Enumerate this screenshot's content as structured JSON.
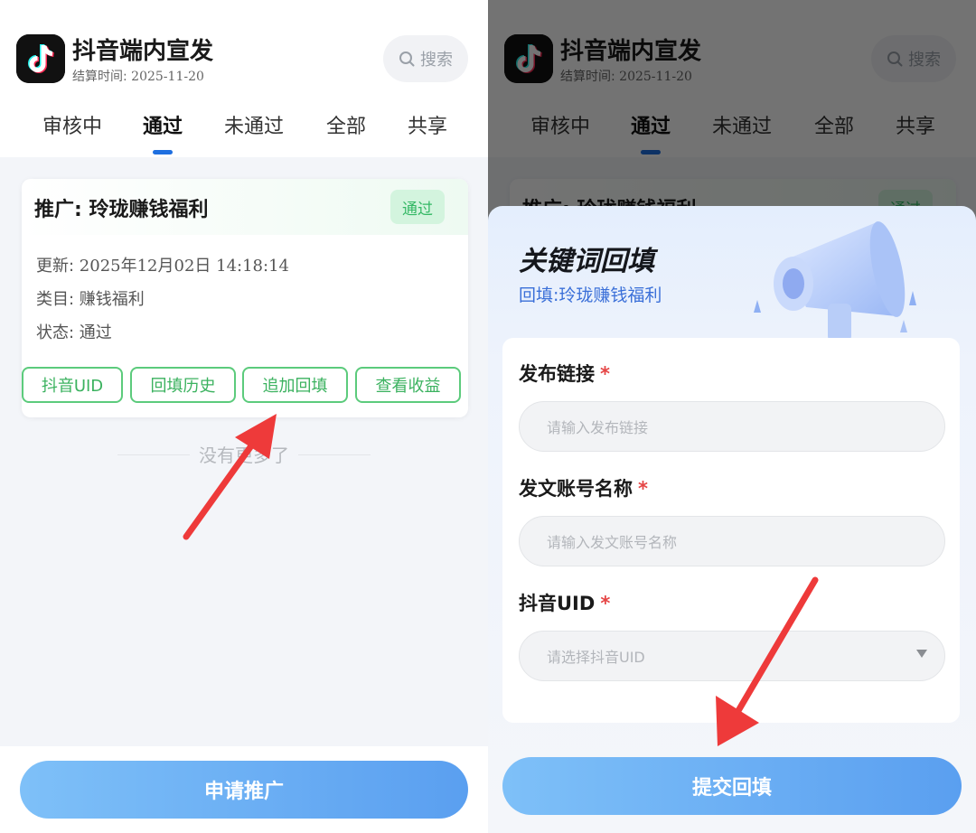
{
  "app": {
    "title": "抖音端内宣发",
    "settle_label": "结算时间: ",
    "settle_date": "2025-11-20",
    "search_placeholder": "搜索"
  },
  "tabs": [
    {
      "label": "审核中",
      "active": false
    },
    {
      "label": "通过",
      "active": true
    },
    {
      "label": "未通过",
      "active": false
    },
    {
      "label": "全部",
      "active": false
    },
    {
      "label": "共享",
      "active": false
    }
  ],
  "card": {
    "title": "推广: 玲珑赚钱福利",
    "status": "通过",
    "update_label": "更新: ",
    "update_value": "2025年12月02日 14:18:14",
    "category": "类目: 赚钱福利",
    "state": "状态: 通过",
    "buttons": [
      "抖音UID",
      "回填历史",
      "追加回填",
      "查看收益"
    ]
  },
  "list_end": "没有更多了",
  "apply_button": "申请推广",
  "sheet": {
    "title": "关键词回填",
    "subtitle": "回填:玲珑赚钱福利",
    "fields": [
      {
        "label": "发布链接",
        "required": "*",
        "placeholder": "请输入发布链接"
      },
      {
        "label": "发文账号名称",
        "required": "*",
        "placeholder": "请输入发文账号名称"
      },
      {
        "label": "抖音UID",
        "required": "*",
        "placeholder": "请选择抖音UID"
      }
    ],
    "submit": "提交回填"
  },
  "colors": {
    "accent_blue": "#1e6fe0",
    "success_green": "#3bb25f",
    "required_red": "#e54545",
    "arrow_red": "#ee3a3a",
    "button_gradient_start": "#7ec0f8",
    "button_gradient_end": "#5a9ff0"
  },
  "icons": [
    "tiktok-logo-icon",
    "search-icon",
    "megaphone-icon",
    "chevron-down-icon",
    "red-arrow-annotation"
  ]
}
